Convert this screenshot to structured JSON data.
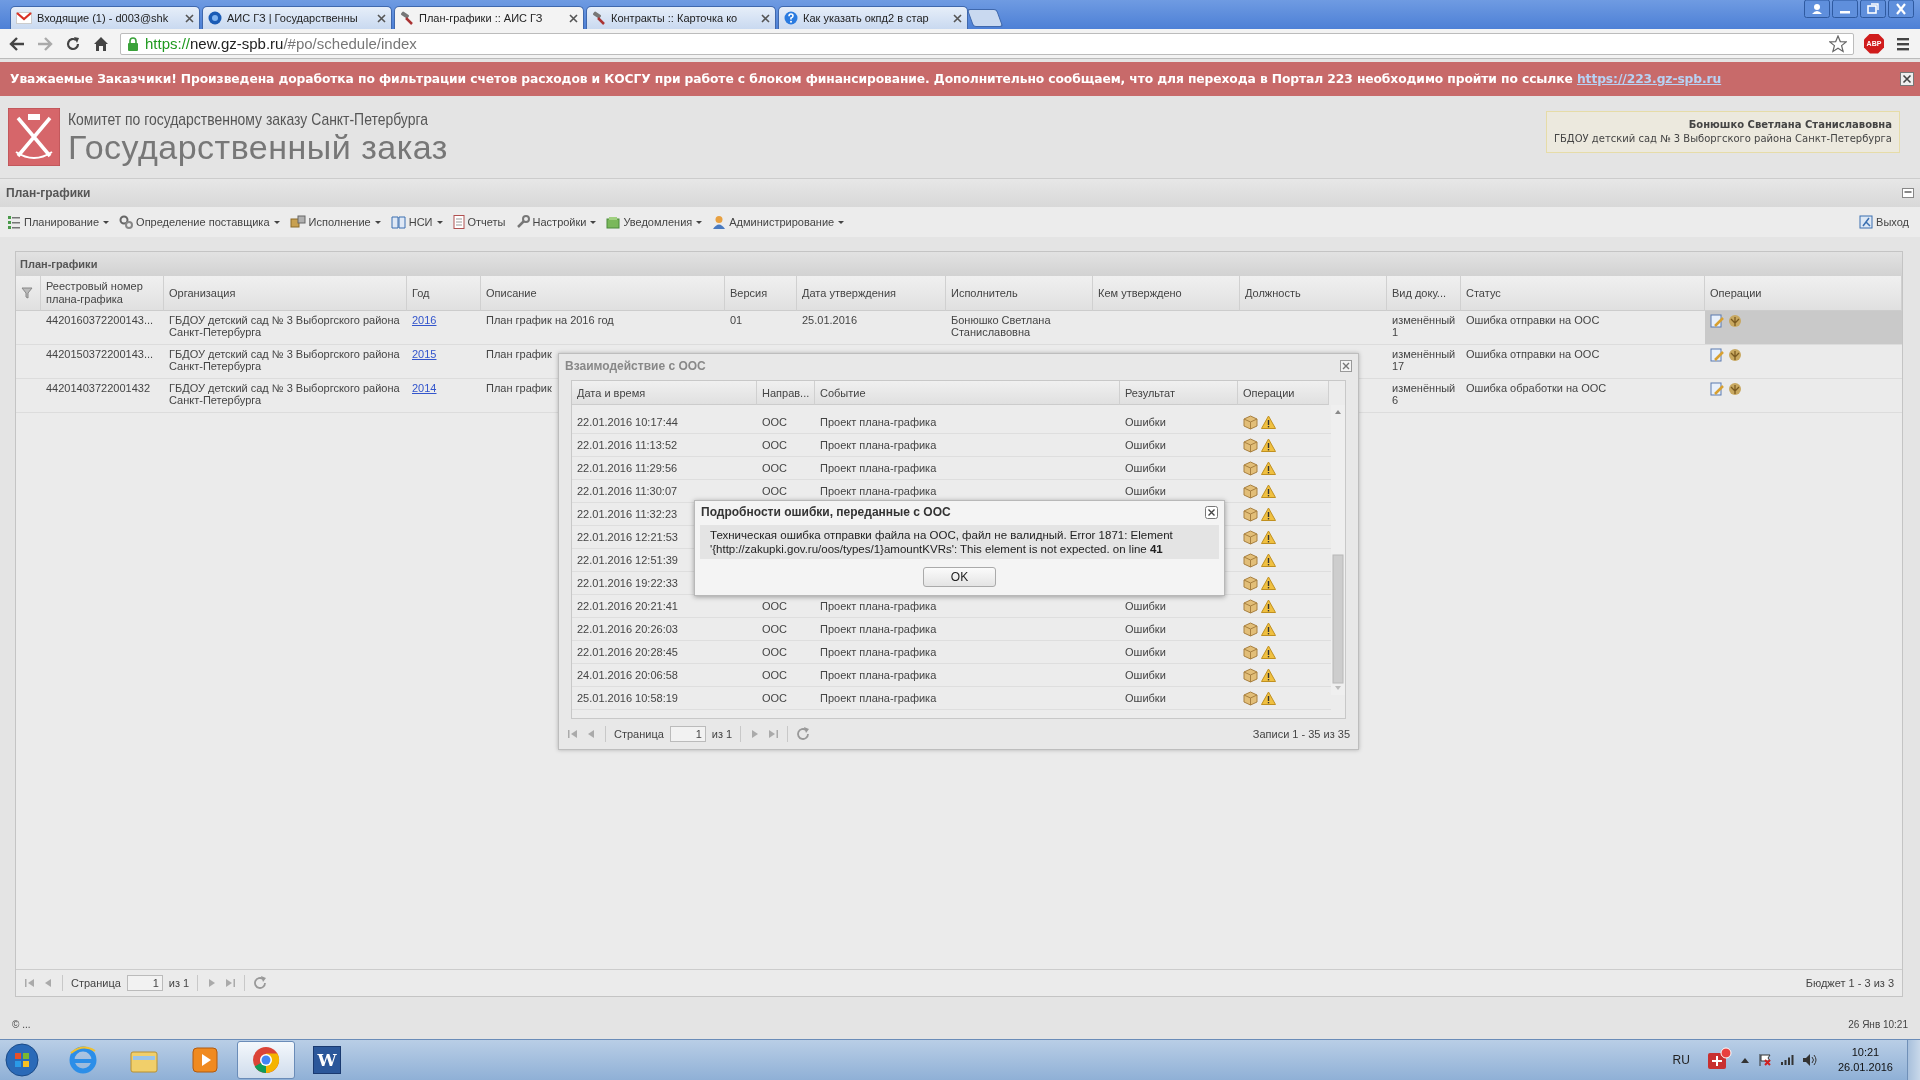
{
  "browser": {
    "tabs": [
      {
        "kind": "mail",
        "title": "Входящие (1) - d003@shk",
        "selected": false
      },
      {
        "kind": "site",
        "title": "АИС ГЗ | Государственны",
        "selected": false
      },
      {
        "kind": "gavel",
        "title": "План-графики :: АИС ГЗ",
        "selected": true
      },
      {
        "kind": "gavel",
        "title": "Контракты :: Карточка ко",
        "selected": false
      },
      {
        "kind": "help",
        "title": "Как указать окпд2 в стар",
        "selected": false
      }
    ],
    "url": {
      "scheme": "https://",
      "host": "new.gz-spb.ru",
      "path": "/#po/schedule/index"
    },
    "extension_badge": "ABP"
  },
  "banner": {
    "text": "Уважаемые Заказчики! Произведена доработка по фильтрации счетов расходов и КОСГУ при работе с блоком финансирование. Дополнительно сообщаем, что для перехода в Портал 223 необходимо пройти по ссылке",
    "link": "https://223.gz-spb.ru"
  },
  "header": {
    "organization": "Комитет по государственному заказу Санкт-Петербурга",
    "title": "Государственный заказ",
    "user": {
      "name": "Бонюшко Светлана Станиславовна",
      "organization": "ГБДОУ детский сад № 3 Выборгского района Санкт-Петербурга"
    }
  },
  "section_title": "План-графики",
  "toolbar": {
    "menus": [
      {
        "kind": "planning",
        "label": "Планирование",
        "dropdown": true
      },
      {
        "kind": "supplier",
        "label": "Определение поставщика",
        "dropdown": true
      },
      {
        "kind": "execution",
        "label": "Исполнение",
        "dropdown": true
      },
      {
        "kind": "reference",
        "label": "НСИ",
        "dropdown": true
      },
      {
        "kind": "reports",
        "label": "Отчеты",
        "dropdown": false
      },
      {
        "kind": "settings",
        "label": "Настройки",
        "dropdown": true
      },
      {
        "kind": "notifications",
        "label": "Уведомления",
        "dropdown": true
      },
      {
        "kind": "admin",
        "label": "Администрирование",
        "dropdown": true
      }
    ],
    "exit": "Выход"
  },
  "grid": {
    "title": "План-графики",
    "columns": [
      "Реестровый номер плана-графика",
      "Организация",
      "Год",
      "Описание",
      "Версия",
      "Дата утверждения",
      "Исполнитель",
      "Кем утверждено",
      "Должность",
      "Вид доку...",
      "Статус",
      "Операции"
    ],
    "rows": [
      {
        "selected": true,
        "number": "4420160372200143...",
        "organization": "ГБДОУ детский сад № 3 Выборгского района Санкт-Петербурга",
        "year": "2016",
        "description": "План график на 2016 год",
        "version": "01",
        "approval_date": "25.01.2016",
        "executor": "Бонюшко Светлана Станиславовна",
        "doc_type": "изменённый 1",
        "status": "Ошибка отправки на ООС"
      },
      {
        "selected": false,
        "number": "4420150372200143...",
        "organization": "ГБДОУ детский сад № 3 Выборгского района Санкт-Петербурга",
        "year": "2015",
        "description": "План график",
        "doc_type": "изменённый 17",
        "status": "Ошибка отправки на ООС"
      },
      {
        "selected": false,
        "number": "44201403722001432",
        "organization": "ГБДОУ детский сад № 3 Выборгского района Санкт-Петербурга",
        "year": "2014",
        "description": "План график",
        "doc_type": "изменённый 6",
        "status": "Ошибка обработки на ООС"
      }
    ],
    "pager": {
      "page_label": "Страница",
      "page": "1",
      "of": "из 1",
      "summary": "Бюджет 1 - 3 из 3"
    }
  },
  "ooc_dialog": {
    "title": "Взаимодействие с ООС",
    "columns": [
      "Дата и время",
      "Направ...",
      "Событие",
      "Результат",
      "Операции"
    ],
    "rows": [
      {
        "datetime": "22.01.2016 10:17:44",
        "direction": "ООС",
        "event": "Проект плана-графика",
        "result": "Ошибки"
      },
      {
        "datetime": "22.01.2016 11:13:52",
        "direction": "ООС",
        "event": "Проект плана-графика",
        "result": "Ошибки"
      },
      {
        "datetime": "22.01.2016 11:29:56",
        "direction": "ООС",
        "event": "Проект плана-графика",
        "result": "Ошибки"
      },
      {
        "datetime": "22.01.2016 11:30:07",
        "direction": "ООС",
        "event": "Проект плана-графика",
        "result": "Ошибки"
      },
      {
        "datetime": "22.01.2016 11:32:23"
      },
      {
        "datetime": "22.01.2016 12:21:53"
      },
      {
        "datetime": "22.01.2016 12:51:39"
      },
      {
        "datetime": "22.01.2016 19:22:33"
      },
      {
        "datetime": "22.01.2016 20:21:41",
        "direction": "ООС",
        "event": "Проект плана-графика",
        "result": "Ошибки"
      },
      {
        "datetime": "22.01.2016 20:26:03",
        "direction": "ООС",
        "event": "Проект плана-графика",
        "result": "Ошибки"
      },
      {
        "datetime": "22.01.2016 20:28:45",
        "direction": "ООС",
        "event": "Проект плана-графика",
        "result": "Ошибки"
      },
      {
        "datetime": "24.01.2016 20:06:58",
        "direction": "ООС",
        "event": "Проект плана-графика",
        "result": "Ошибки"
      },
      {
        "datetime": "25.01.2016 10:58:19",
        "direction": "ООС",
        "event": "Проект плана-графика",
        "result": "Ошибки"
      }
    ],
    "pager": {
      "page_label": "Страница",
      "page": "1",
      "of": "из 1",
      "summary": "Записи 1 - 35 из 35"
    }
  },
  "error_dialog": {
    "title": "Подробности ошибки, переданные с ООС",
    "message": "Техническая ошибка отправки файла на ООС, файл не валидный. Error 1871: Element '{http://zakupki.gov.ru/oos/types/1}amountKVRs': This element is not expected. on line **41**",
    "button": "OK"
  },
  "status_bar": {
    "left": "© ...",
    "right": "26 Янв 10:21"
  },
  "taskbar": {
    "apps": [
      {
        "kind": "ie",
        "selected": false
      },
      {
        "kind": "explorer",
        "selected": false
      },
      {
        "kind": "media",
        "selected": false
      },
      {
        "kind": "chrome",
        "selected": true
      },
      {
        "kind": "word",
        "glyph": "W",
        "selected": false
      }
    ],
    "language": "RU",
    "time": "10:21",
    "date": "26.01.2016"
  }
}
